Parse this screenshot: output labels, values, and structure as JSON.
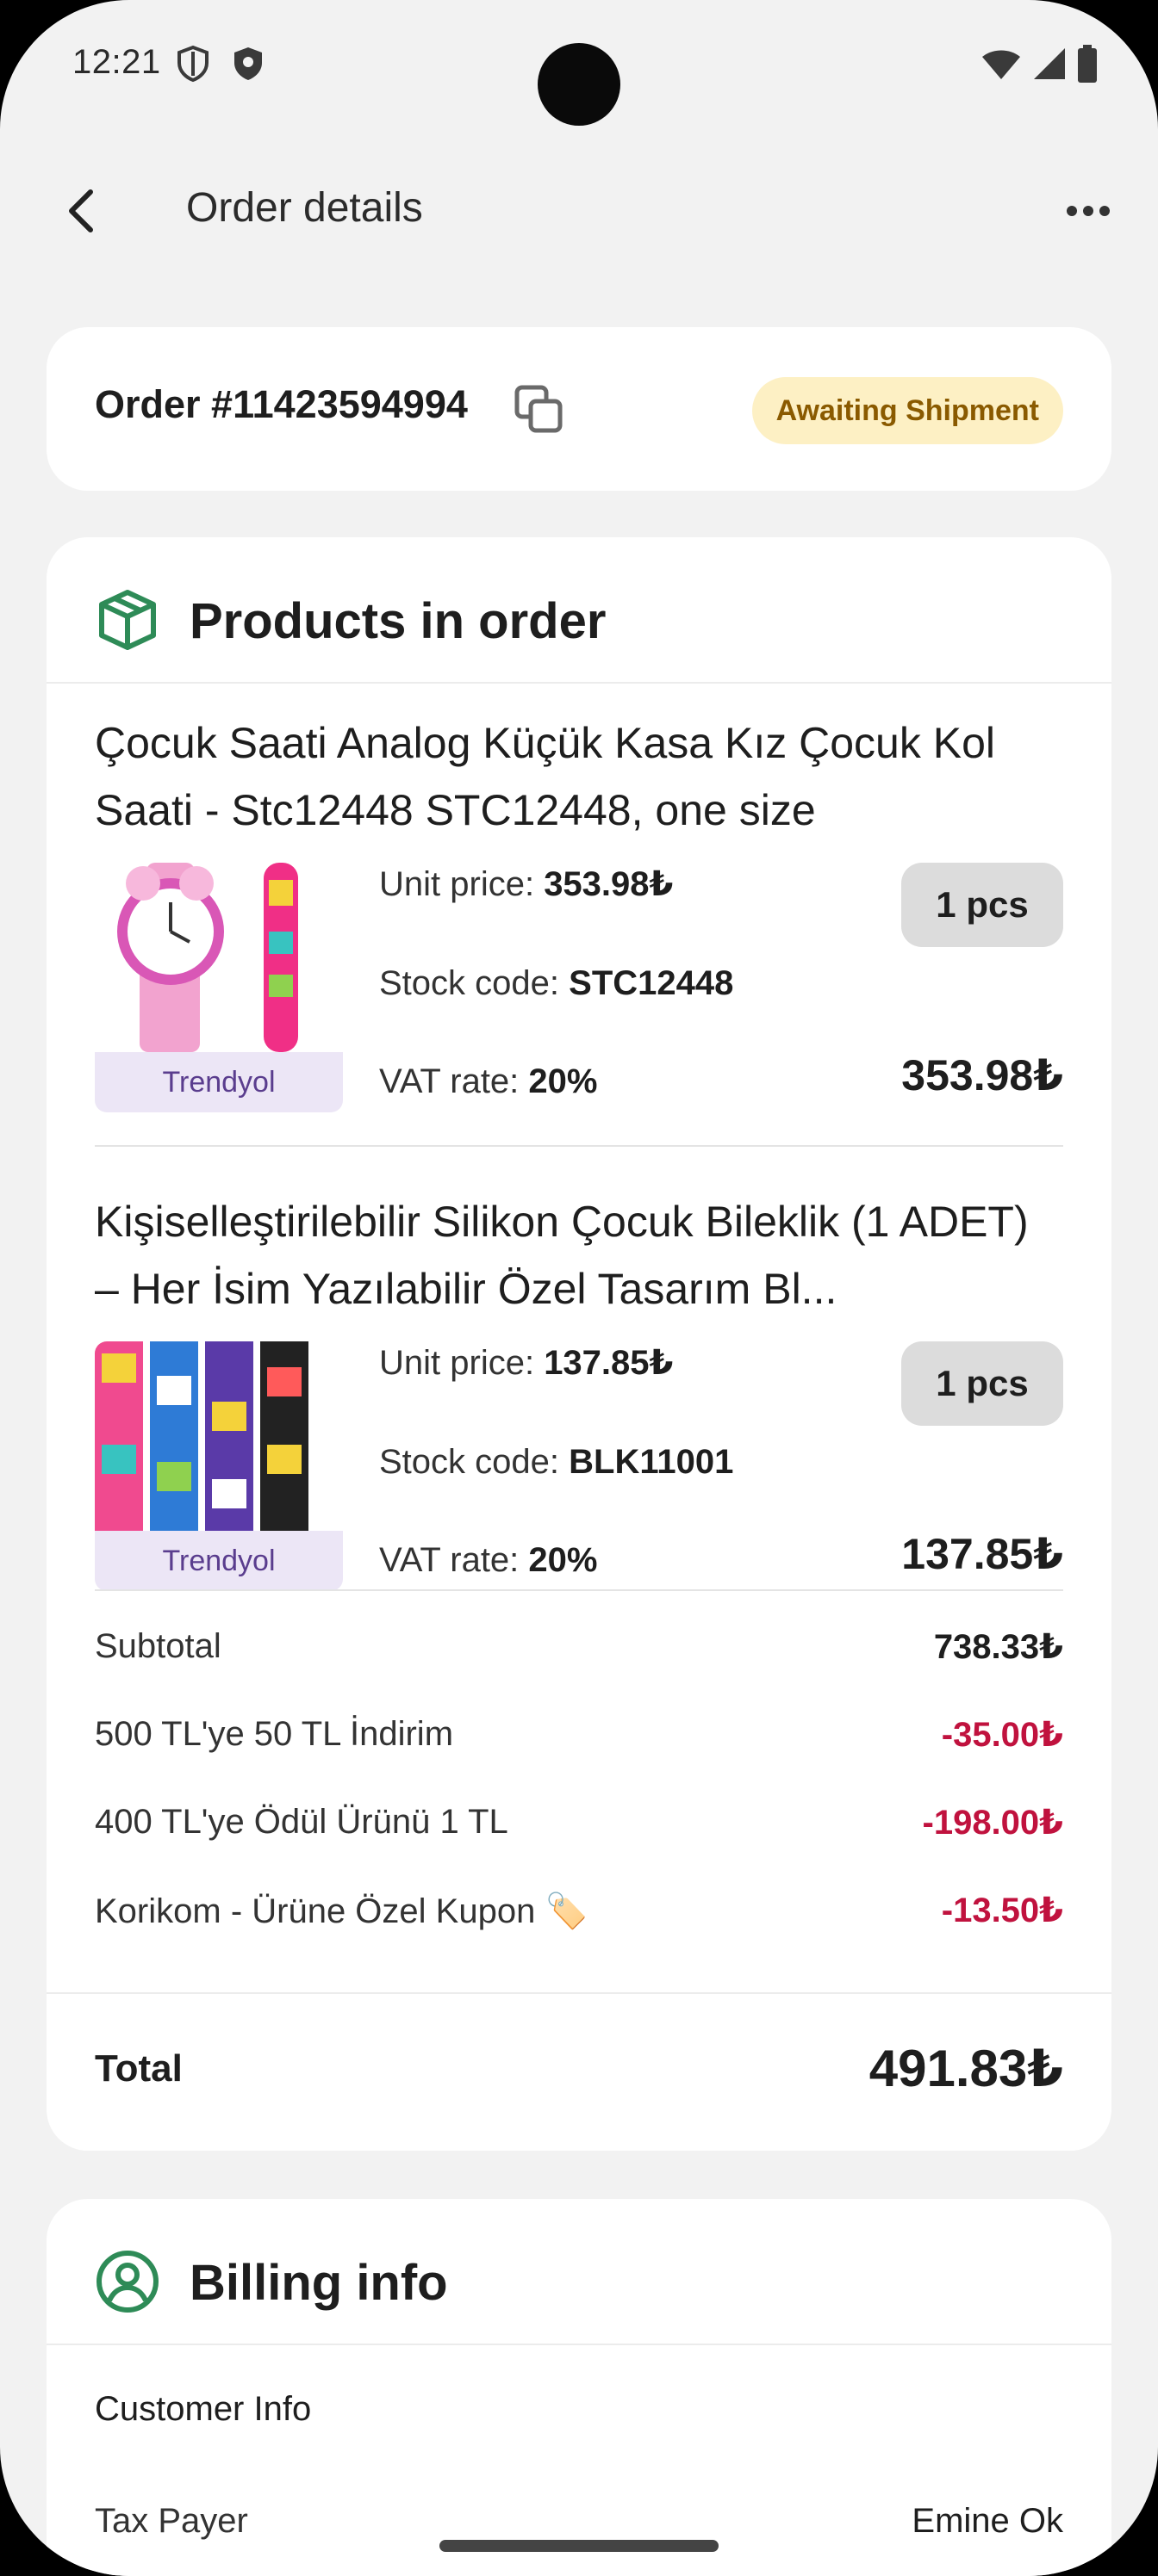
{
  "status_bar": {
    "time": "12:21"
  },
  "app_bar": {
    "title": "Order details"
  },
  "order": {
    "number": "Order #11423594994",
    "status": "Awaiting Shipment",
    "colors": {
      "status_bg": "#fdf0c4",
      "status_text": "#8a5a00"
    }
  },
  "products": {
    "section_title": "Products in order",
    "items": [
      {
        "name": "Çocuk Saati Analog Küçük Kasa Kız Çocuk Kol Saati - Stc12448 STC12448, one size",
        "brand": "Trendyol",
        "unit_price_label": "Unit price:",
        "unit_price": "353.98₺",
        "stock_code_label": "Stock code:",
        "stock_code": "STC12448",
        "vat_label": "VAT rate:",
        "vat": "20%",
        "quantity": "1 pcs",
        "price": "353.98₺"
      },
      {
        "name": "Kişiselleştirilebilir Silikon Çocuk Bileklik (1 ADET) – Her İsim Yazılabilir Özel Tasarım Bl...",
        "brand": "Trendyol",
        "unit_price_label": "Unit price:",
        "unit_price": "137.85₺",
        "stock_code_label": "Stock code:",
        "stock_code": "BLK11001",
        "vat_label": "VAT rate:",
        "vat": "20%",
        "quantity": "1 pcs",
        "price": "137.85₺"
      }
    ],
    "summary": [
      {
        "label": "Subtotal",
        "value": "738.33₺"
      },
      {
        "label": "500 TL'ye 50 TL İndirim",
        "value": "-35.00₺"
      },
      {
        "label": "400 TL'ye Ödül Ürünü 1 TL",
        "value": "-198.00₺"
      },
      {
        "label": "Korikom - Ürüne Özel Kupon 🏷️",
        "value": "-13.50₺"
      }
    ],
    "total_label": "Total",
    "total_value": "491.83₺"
  },
  "billing": {
    "section_title": "Billing info",
    "customer_info_label": "Customer Info",
    "tax_payer_label": "Tax Payer",
    "tax_payer_value": "Emine Ok"
  },
  "colors": {
    "accent_green": "#2e8b57",
    "negative": "#c0123e",
    "brand_bg": "#ece6f6"
  }
}
